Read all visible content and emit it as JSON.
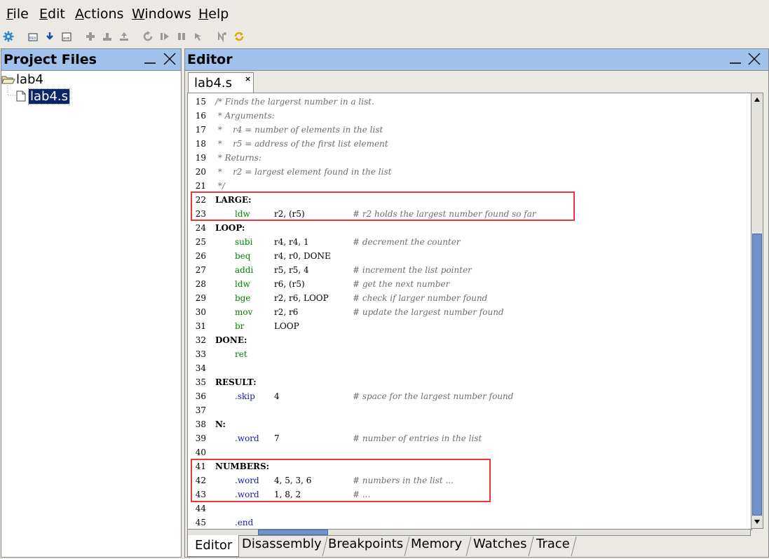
{
  "menubar": [
    {
      "mnemonic": "F",
      "rest": "ile"
    },
    {
      "mnemonic": "E",
      "rest": "dit"
    },
    {
      "mnemonic": "A",
      "rest": "ctions"
    },
    {
      "mnemonic": "W",
      "rest": "indows"
    },
    {
      "mnemonic": "H",
      "rest": "elp"
    }
  ],
  "toolbar_icons": [
    "gear-icon",
    "load-binary-icon",
    "download-icon",
    "compile-icon",
    "step-into-icon",
    "step-over-icon",
    "step-out-icon",
    "restart-icon",
    "continue-icon",
    "stop-icon",
    "breakpoint-icon",
    "cursor-run-icon",
    "refresh-icon"
  ],
  "project_panel": {
    "title": "Project Files",
    "tree": [
      {
        "label": "lab4",
        "kind": "folder"
      },
      {
        "label": "lab4.s",
        "kind": "file",
        "selected": true
      }
    ]
  },
  "editor_panel": {
    "title": "Editor",
    "tab": "lab4.s",
    "tab_close": "×",
    "lines": [
      {
        "n": "15",
        "kind": "comment",
        "text": "/* Finds the largerst number in a list."
      },
      {
        "n": "16",
        "kind": "comment",
        "text": " * Arguments:"
      },
      {
        "n": "17",
        "kind": "comment",
        "text": " *    r4 = number of elements in the list"
      },
      {
        "n": "18",
        "kind": "comment",
        "text": " *    r5 = address of the first list element"
      },
      {
        "n": "19",
        "kind": "comment",
        "text": " * Returns:"
      },
      {
        "n": "20",
        "kind": "comment",
        "text": " *    r2 = largest element found in the list"
      },
      {
        "n": "21",
        "kind": "comment",
        "text": " */"
      },
      {
        "n": "22",
        "kind": "label",
        "text": "LARGE:"
      },
      {
        "n": "23",
        "kind": "code",
        "op": "ldw",
        "args": "r2, (r5)",
        "comment": "# r2 holds the largest number found so far"
      },
      {
        "n": "24",
        "kind": "label",
        "text": "LOOP:"
      },
      {
        "n": "25",
        "kind": "code",
        "op": "subi",
        "args": "r4, r4, 1",
        "comment": "# decrement the counter"
      },
      {
        "n": "26",
        "kind": "code",
        "op": "beq",
        "args": "r4, r0, DONE",
        "comment": ""
      },
      {
        "n": "27",
        "kind": "code",
        "op": "addi",
        "args": "r5, r5, 4",
        "comment": "# increment the list pointer"
      },
      {
        "n": "28",
        "kind": "code",
        "op": "ldw",
        "args": "r6, (r5)",
        "comment": "# get the next number"
      },
      {
        "n": "29",
        "kind": "code",
        "op": "bge",
        "args": "r2, r6, LOOP",
        "comment": "# check if larger number found"
      },
      {
        "n": "30",
        "kind": "code",
        "op": "mov",
        "args": "r2, r6",
        "comment": "# update the largest number found"
      },
      {
        "n": "31",
        "kind": "code",
        "op": "br",
        "args": "LOOP",
        "comment": ""
      },
      {
        "n": "32",
        "kind": "label",
        "text": "DONE:"
      },
      {
        "n": "33",
        "kind": "code",
        "op": "ret",
        "args": "",
        "comment": ""
      },
      {
        "n": "34",
        "kind": "blank"
      },
      {
        "n": "35",
        "kind": "label",
        "text": "RESULT:"
      },
      {
        "n": "36",
        "kind": "directive",
        "op": ".skip",
        "args": "4",
        "comment": "# space for the largest number found"
      },
      {
        "n": "37",
        "kind": "blank"
      },
      {
        "n": "38",
        "kind": "label",
        "text": "N:"
      },
      {
        "n": "39",
        "kind": "directive",
        "op": ".word",
        "args": "7",
        "comment": "# number of entries in the list"
      },
      {
        "n": "40",
        "kind": "blank"
      },
      {
        "n": "41",
        "kind": "label",
        "text": "NUMBERS:"
      },
      {
        "n": "42",
        "kind": "directive",
        "op": ".word",
        "args": "4, 5, 3, 6",
        "comment": "# numbers in the list ..."
      },
      {
        "n": "43",
        "kind": "directive",
        "op": ".word",
        "args": "1, 8, 2",
        "comment": "# ..."
      },
      {
        "n": "44",
        "kind": "blank"
      },
      {
        "n": "45",
        "kind": "directive",
        "op": ".end",
        "args": "",
        "comment": ""
      }
    ]
  },
  "bottom_tabs": [
    "Editor",
    "Disassembly",
    "Breakpoints",
    "Memory",
    "Watches",
    "Trace"
  ],
  "colors": {
    "panel_header": "#9fc1ea",
    "instruction": "#008000",
    "directive": "#1a1aa6",
    "comment": "#6e6e6e",
    "highlight_box": "#e8383d",
    "selection": "#0a246a"
  }
}
